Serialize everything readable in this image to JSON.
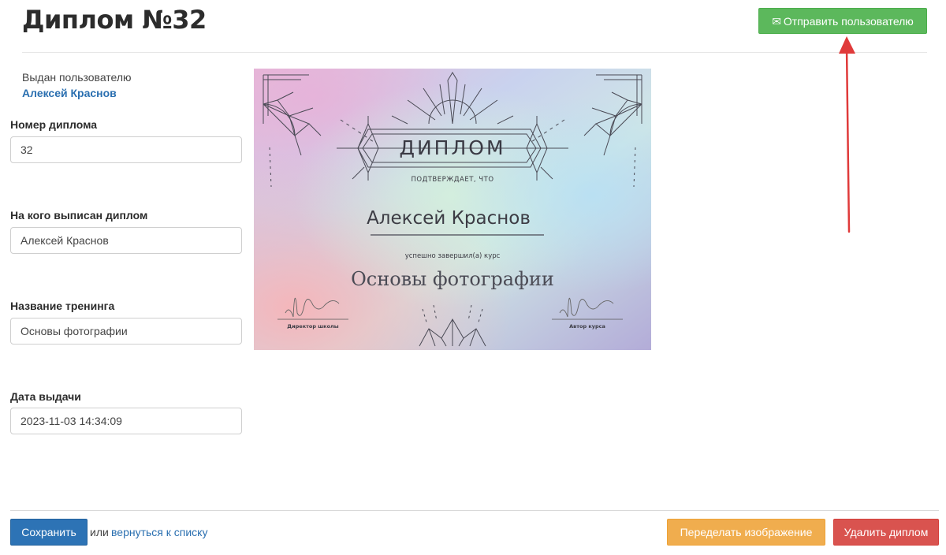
{
  "page": {
    "title": "Диплом №32",
    "send_button_label": "Отправить пользователю",
    "send_icon": "envelope-icon"
  },
  "issued": {
    "label": "Выдан пользователю",
    "user_name": "Алексей Краснов"
  },
  "form": {
    "number_label": "Номер диплома",
    "number_value": "32",
    "recipient_label": "На кого выписан диплом",
    "recipient_value": "Алексей Краснов",
    "training_label": "Название тренинга",
    "training_value": "Основы фотографии",
    "date_label": "Дата выдачи",
    "date_value": "2023-11-03 14:34:09"
  },
  "diploma": {
    "heading": "ДИПЛОМ",
    "confirms": "ПОДТВЕРЖДАЕТ, ЧТО",
    "recipient": "Алексей Краснов",
    "completed": "успешно завершил(а) курс",
    "course": "Основы фотографии",
    "sig_left_caption": "Директор школы",
    "sig_right_caption": "Автор курса"
  },
  "footer": {
    "save_label": "Сохранить",
    "or_text": "или",
    "back_link": "вернуться к списку",
    "redo_label": "Переделать изображение",
    "delete_label": "Удалить диплом"
  },
  "colors": {
    "success": "#5cb85c",
    "primary": "#2d73b5",
    "warning": "#f0ad4e",
    "danger": "#d9534f",
    "link": "#2a6fb0",
    "annotation_arrow": "#e03a3a"
  }
}
